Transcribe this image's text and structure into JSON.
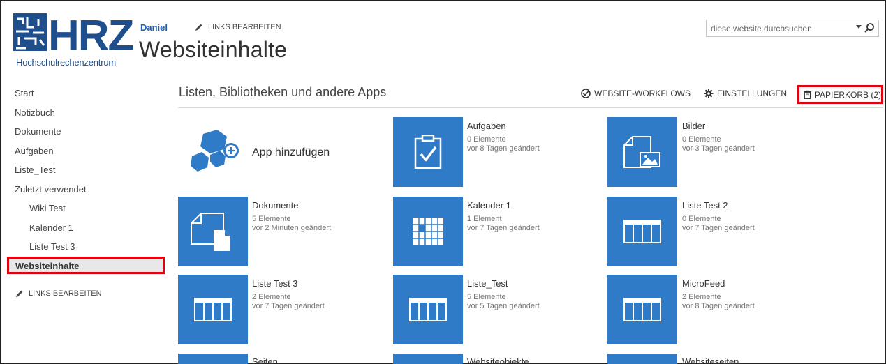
{
  "header": {
    "logo_text": "HRZ",
    "logo_subtitle": "Hochschulrechenzentrum",
    "user_name": "Daniel",
    "edit_links": "LINKS BEARBEITEN",
    "page_title": "Websiteinhalte",
    "search_placeholder": "diese website durchsuchen"
  },
  "nav": {
    "items": [
      {
        "label": "Start",
        "level": 0
      },
      {
        "label": "Notizbuch",
        "level": 0
      },
      {
        "label": "Dokumente",
        "level": 0
      },
      {
        "label": "Aufgaben",
        "level": 0
      },
      {
        "label": "Liste_Test",
        "level": 0
      },
      {
        "label": "Zuletzt verwendet",
        "level": 0
      },
      {
        "label": "Wiki Test",
        "level": 1
      },
      {
        "label": "Kalender 1",
        "level": 1
      },
      {
        "label": "Liste Test 3",
        "level": 1
      }
    ],
    "current": "Websiteinhalte",
    "edit_links": "LINKS BEARBEITEN"
  },
  "main": {
    "section_title": "Listen, Bibliotheken und andere Apps",
    "toolbar": {
      "workflows": "WEBSITE-WORKFLOWS",
      "settings": "EINSTELLUNGEN",
      "trash": "PAPIERKORB (2)"
    },
    "add_app": "App hinzufügen",
    "apps": [
      {
        "name": "Aufgaben",
        "count": "0 Elemente",
        "modified": "vor 8 Tagen geändert",
        "icon": "tasks-icon"
      },
      {
        "name": "Bilder",
        "count": "0 Elemente",
        "modified": "vor 3 Tagen geändert",
        "icon": "picture-library-icon"
      },
      {
        "name": "Dokumente",
        "count": "5 Elemente",
        "modified": "vor 2 Minuten geändert",
        "icon": "document-library-icon"
      },
      {
        "name": "Kalender 1",
        "count": "1 Element",
        "modified": "vor 7 Tagen geändert",
        "icon": "calendar-icon"
      },
      {
        "name": "Liste Test 2",
        "count": "0 Elemente",
        "modified": "vor 7 Tagen geändert",
        "icon": "list-icon"
      },
      {
        "name": "Liste Test 3",
        "count": "2 Elemente",
        "modified": "vor 7 Tagen geändert",
        "icon": "list-icon"
      },
      {
        "name": "Liste_Test",
        "count": "5 Elemente",
        "modified": "vor 5 Tagen geändert",
        "icon": "list-icon"
      },
      {
        "name": "MicroFeed",
        "count": "2 Elemente",
        "modified": "vor 8 Tagen geändert",
        "icon": "list-icon"
      },
      {
        "name": "Seiten",
        "icon": "pages-icon"
      },
      {
        "name": "Websiteobjekte",
        "icon": "site-assets-icon"
      },
      {
        "name": "Websiteseiten",
        "icon": "site-pages-icon"
      }
    ]
  },
  "colors": {
    "tile": "#2f7bc8",
    "highlight": "#e3000f",
    "link": "#1f5fb0"
  }
}
